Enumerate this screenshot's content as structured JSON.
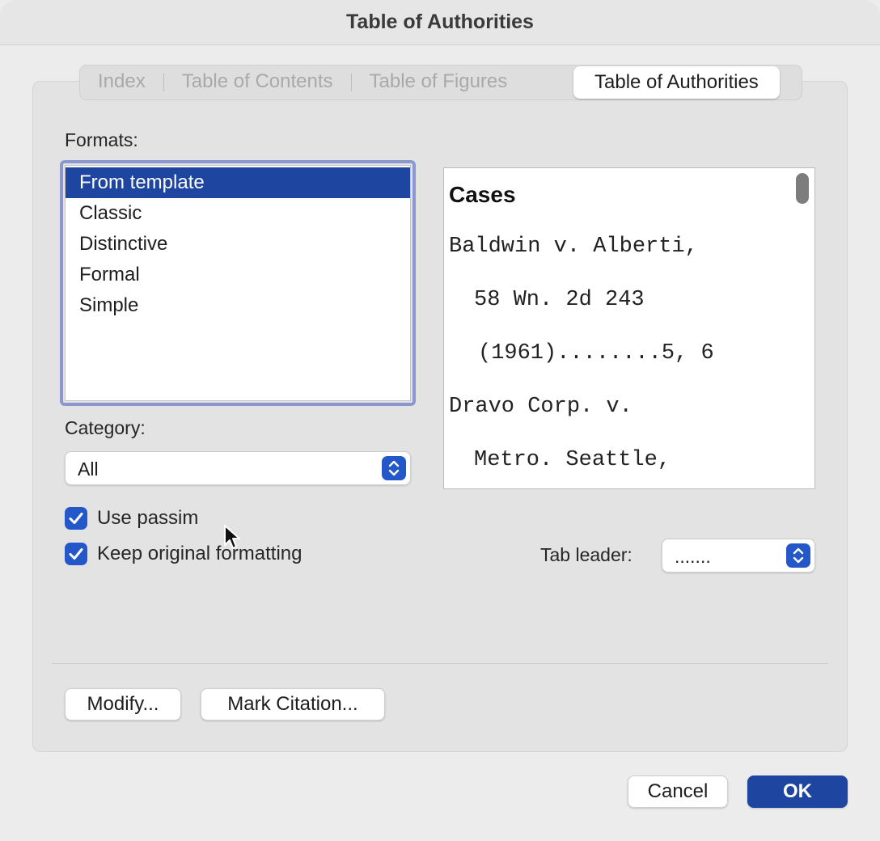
{
  "window": {
    "title": "Table of Authorities"
  },
  "tabs": [
    {
      "label": "Index"
    },
    {
      "label": "Table of Contents"
    },
    {
      "label": "Table of Figures"
    },
    {
      "label": "Table of Authorities",
      "active": true
    }
  ],
  "formats": {
    "label": "Formats:",
    "items": [
      "From template",
      "Classic",
      "Distinctive",
      "Formal",
      "Simple"
    ],
    "selected": "From template"
  },
  "preview": {
    "heading": "Cases",
    "lines": [
      "Baldwin  v.  Alberti,",
      "58   Wn.   2d   243",
      "(1961)........5, 6",
      "Dravo    Corp.    v.",
      "Metro.    Seattle,"
    ]
  },
  "category": {
    "label": "Category:",
    "value": "All"
  },
  "options": {
    "use_passim": {
      "label": "Use passim",
      "checked": true
    },
    "keep_formatting": {
      "label": "Keep original formatting",
      "checked": true
    }
  },
  "tab_leader": {
    "label": "Tab leader:",
    "value": "......."
  },
  "buttons": {
    "modify": "Modify...",
    "mark_citation": "Mark Citation...",
    "cancel": "Cancel",
    "ok": "OK"
  },
  "colors": {
    "accent": "#2457c8",
    "selection": "#1e45a0",
    "focus_ring": "#8a98cf"
  },
  "icons": {
    "stepper": "up-down-chevron-icon",
    "check": "checkmark-icon",
    "cursor": "mouse-pointer-icon"
  }
}
